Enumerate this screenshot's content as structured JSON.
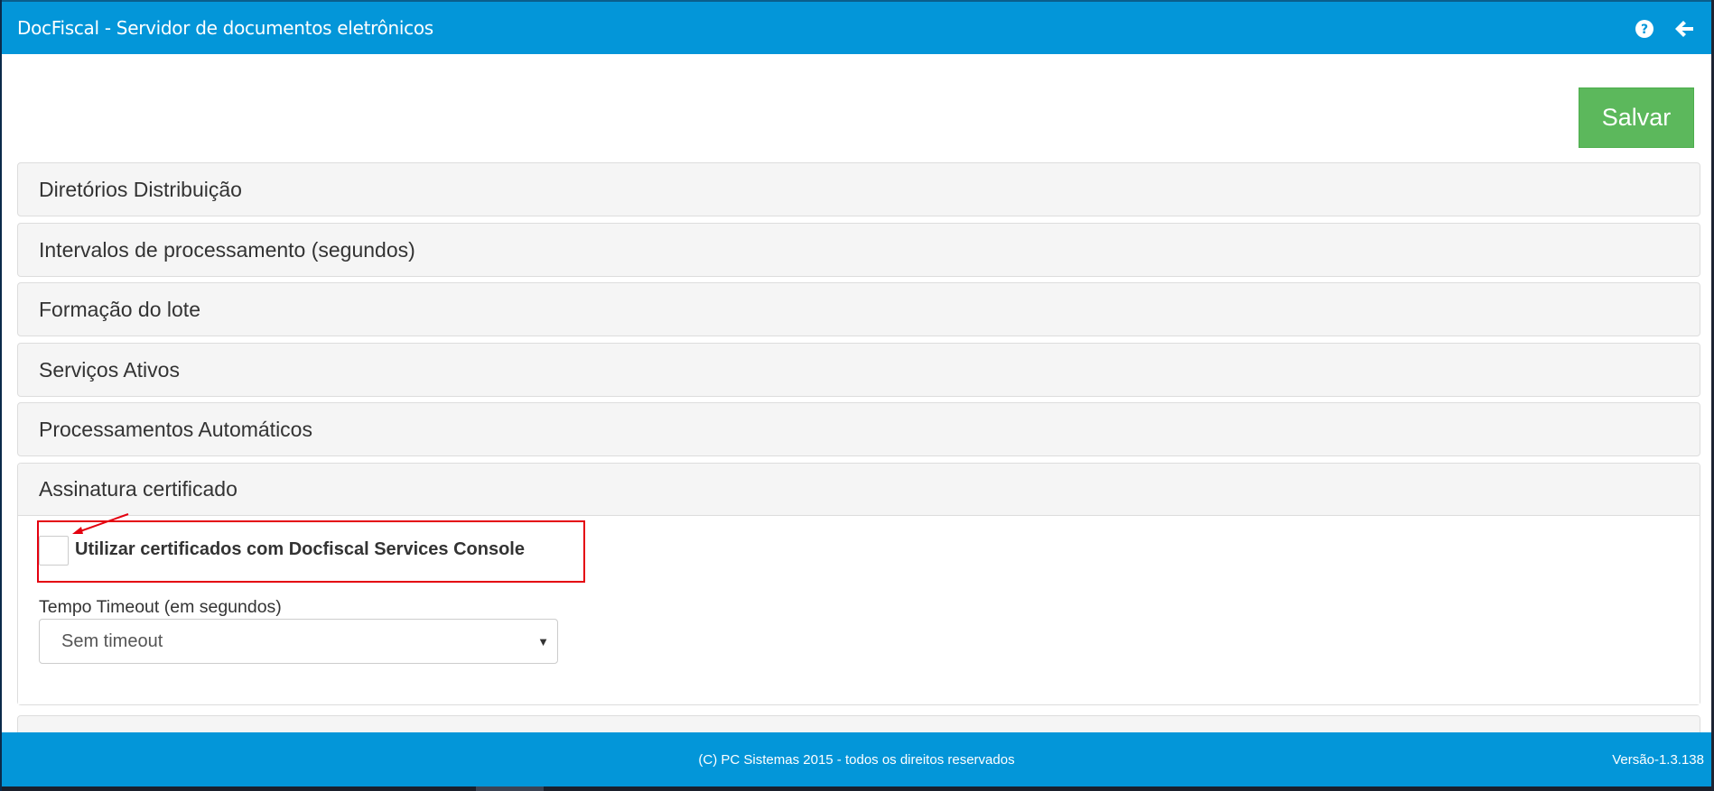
{
  "window": {
    "title": "DocFiscal - Servidor de documentos eletrônicos",
    "help_icon": "question-circle-icon",
    "back_icon": "arrow-left-icon"
  },
  "toolbar": {
    "save_label": "Salvar"
  },
  "panels": [
    {
      "title": "Diretórios Distribuição"
    },
    {
      "title": "Intervalos de processamento (segundos)"
    },
    {
      "title": "Formação do lote"
    },
    {
      "title": "Serviços Ativos"
    },
    {
      "title": "Processamentos Automáticos"
    },
    {
      "title": "Assinatura certificado"
    }
  ],
  "assinatura": {
    "checkbox_label": "Utilizar certificados com Docfiscal Services Console",
    "checkbox_checked": false,
    "timeout_label": "Tempo Timeout (em segundos)",
    "timeout_value": "Sem timeout"
  },
  "footer": {
    "copyright": "(C) PC Sistemas 2015 - todos os direitos reservados",
    "version": "Versão-1.3.138"
  },
  "colors": {
    "header_bg": "#0396d9",
    "save_button": "#5cb85c",
    "highlight": "#e4000f"
  }
}
